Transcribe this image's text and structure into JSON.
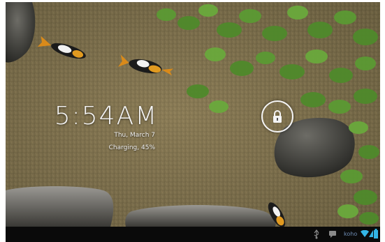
{
  "lockscreen": {
    "time": "5:54AM",
    "date": "Thu, March 7",
    "battery_status": "Charging, 45%",
    "unlock_icon": "lock-icon"
  },
  "statusbar": {
    "carrier": "koho",
    "icons": [
      "usb-icon",
      "message-icon",
      "wifi-icon",
      "signal-icon",
      "battery-icon"
    ],
    "accent_color": "#33b5e5"
  },
  "colors": {
    "sand": "#8a7a56",
    "statusbar_bg": "#0a0a0a",
    "text": "#f4f4f4"
  }
}
